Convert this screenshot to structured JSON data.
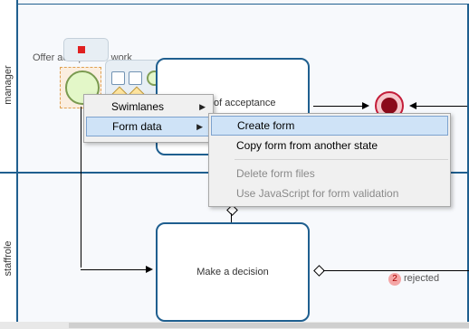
{
  "lanes": {
    "manager": "manager",
    "staffrole": "staffrole"
  },
  "tasks": {
    "offer_label": "Offer acceptance work",
    "acceptance_label": "of acceptance",
    "decision_label": "Make a decision"
  },
  "flow": {
    "rejected_label": "rejected",
    "rejected_count": "2"
  },
  "context_menu": {
    "items": [
      {
        "label": "Swimlanes",
        "arrow": "▶"
      },
      {
        "label": "Form data",
        "arrow": "▶"
      }
    ]
  },
  "submenu": {
    "items": [
      {
        "label": "Create form"
      },
      {
        "label": "Copy form from another state"
      },
      {
        "label": "Delete form files"
      },
      {
        "label": "Use JavaScript for form validation"
      }
    ]
  },
  "colors": {
    "lane_border": "#1f5f8f",
    "end_event": "#c41e3a",
    "start_event": "#e3f7c8",
    "menu_highlight": "#cfe3f7"
  }
}
